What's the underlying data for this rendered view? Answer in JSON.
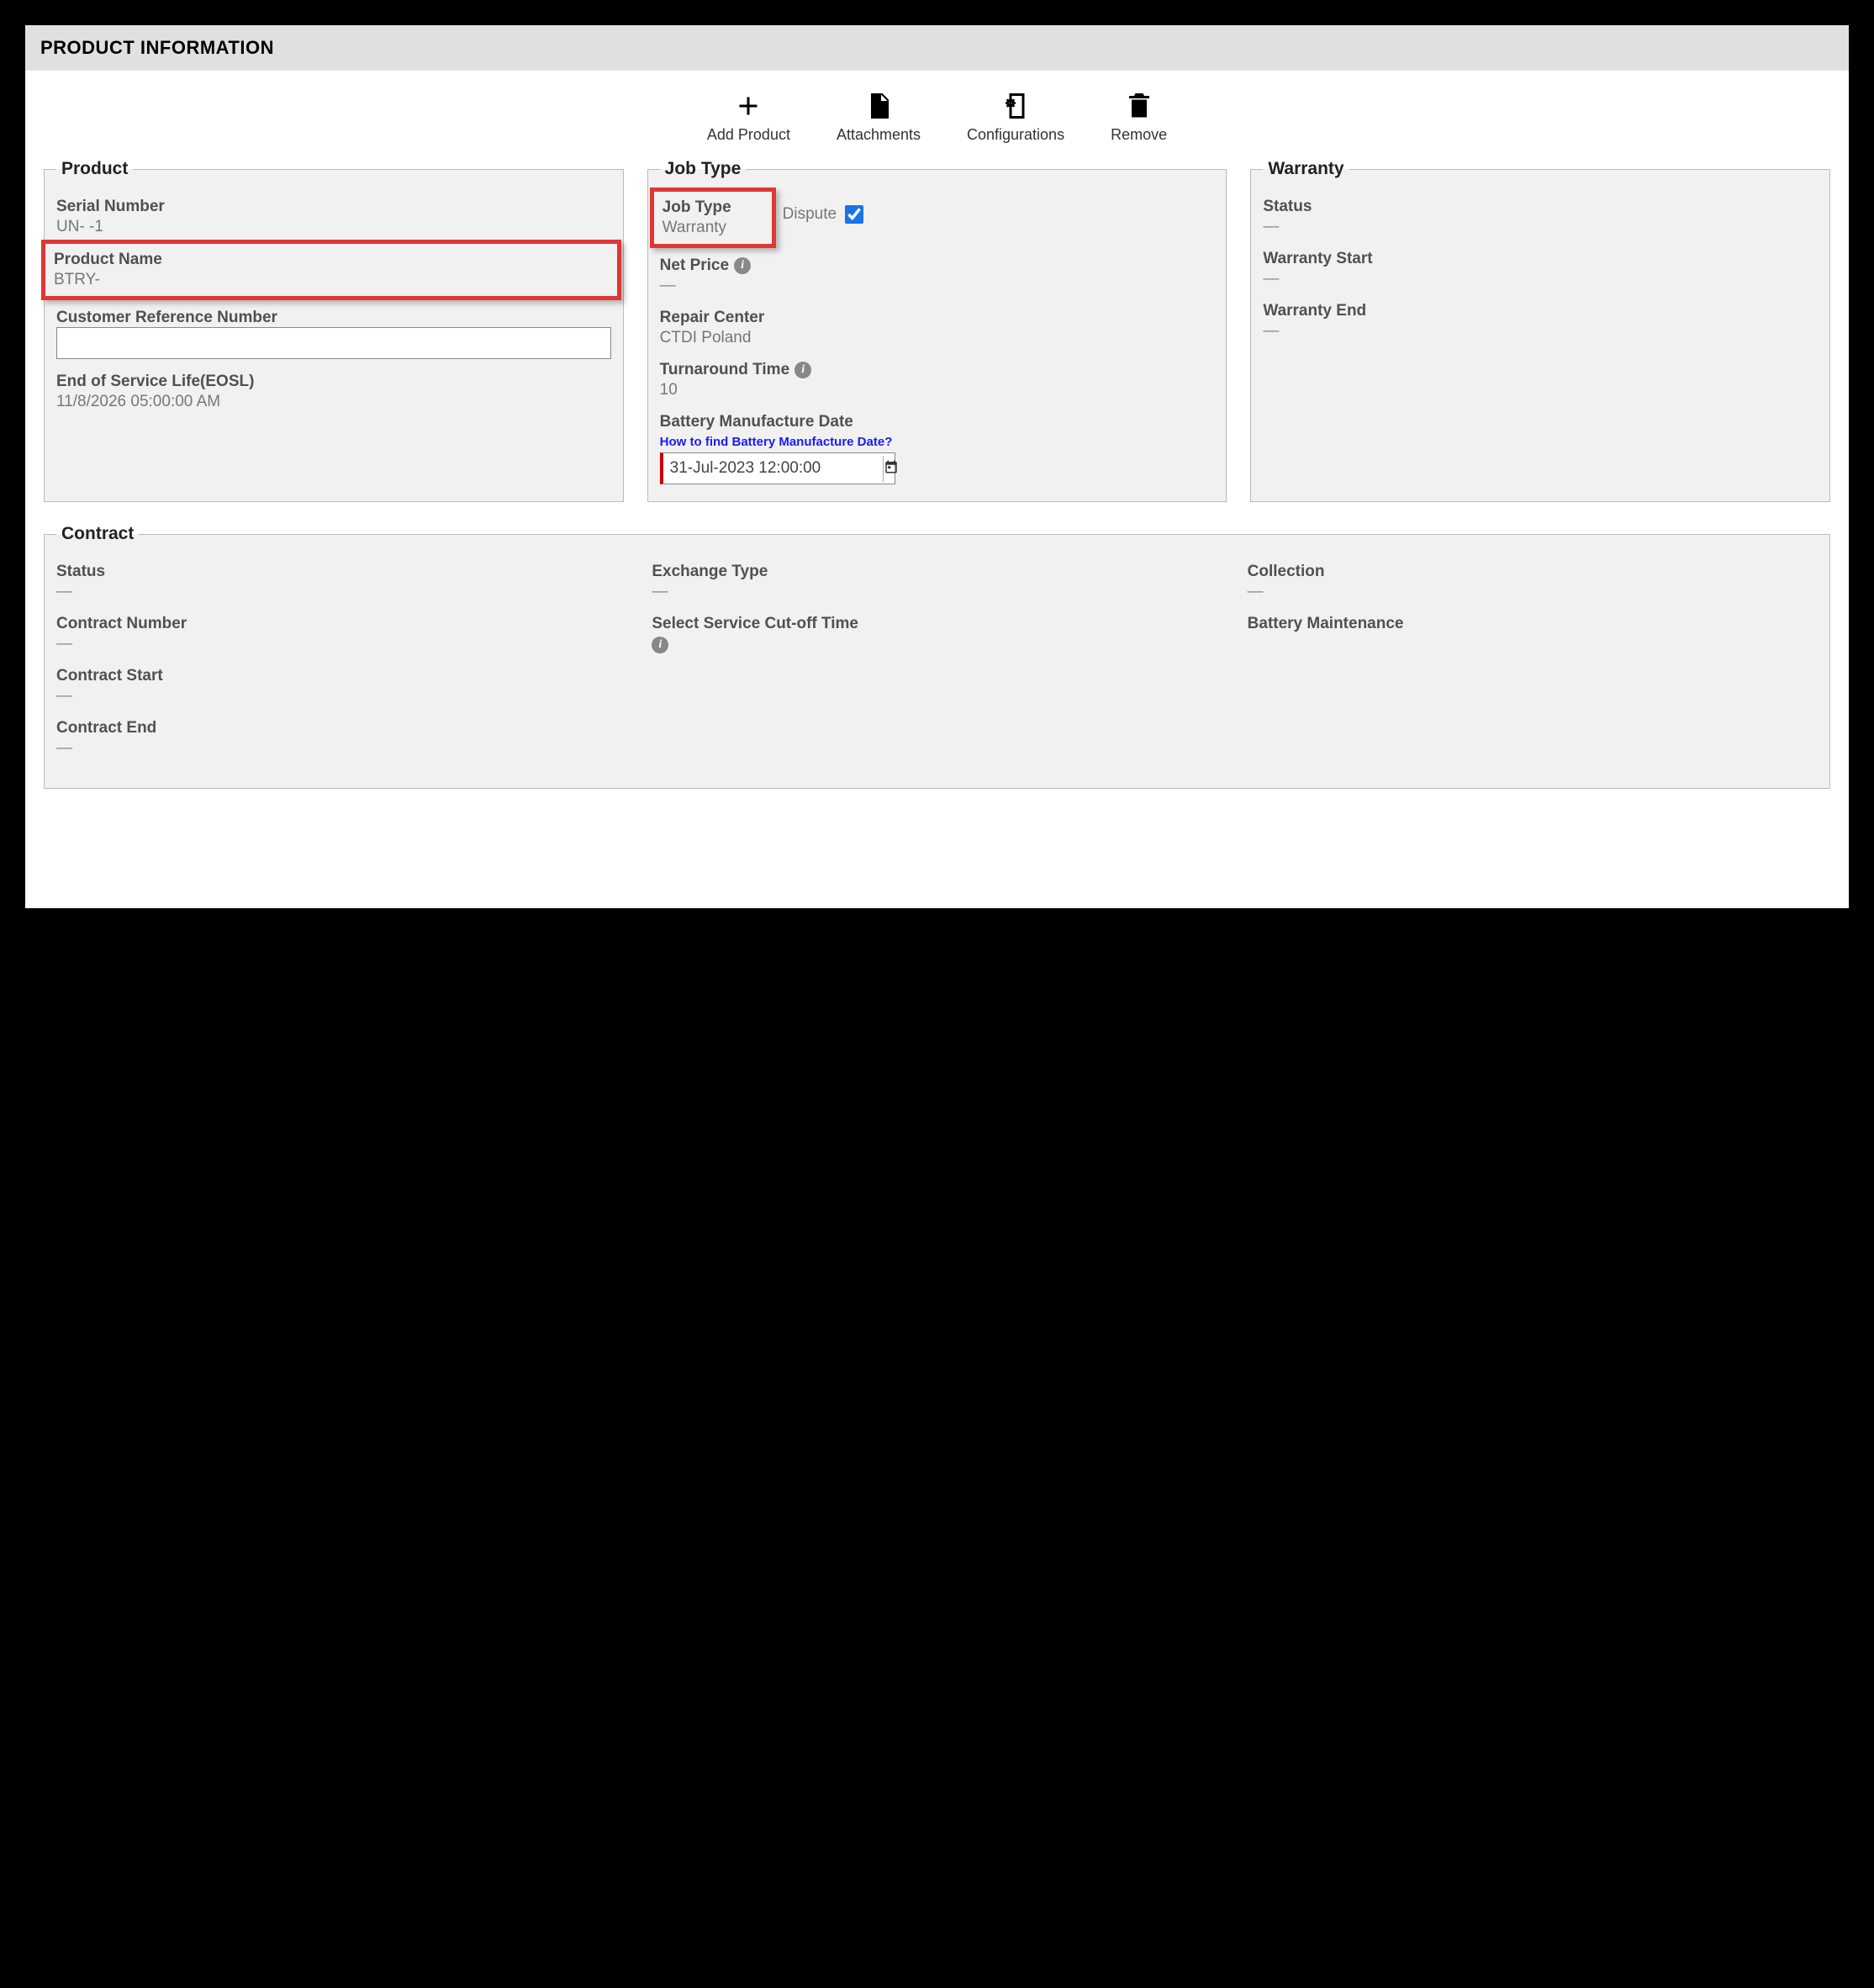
{
  "header": {
    "title": "PRODUCT INFORMATION"
  },
  "toolbar": {
    "add_product": "Add Product",
    "attachments": "Attachments",
    "configurations": "Configurations",
    "remove": "Remove"
  },
  "product": {
    "legend": "Product",
    "serial_label": "Serial Number",
    "serial_value": "UN-               -1",
    "name_label": "Product Name",
    "name_value": "BTRY-",
    "crn_label": "Customer Reference Number",
    "crn_value": "",
    "eosl_label": "End of Service Life(EOSL)",
    "eosl_value": "11/8/2026 05:00:00 AM"
  },
  "jobtype": {
    "legend": "Job Type",
    "jobtype_label": "Job Type",
    "jobtype_value": "Warranty",
    "dispute_label": "Dispute",
    "dispute_checked": true,
    "netprice_label": "Net Price",
    "netprice_value": "—",
    "repair_label": "Repair Center",
    "repair_value": "CTDI Poland",
    "tat_label": "Turnaround Time",
    "tat_value": "10",
    "bmd_label": "Battery Manufacture Date",
    "bmd_help": "How to find Battery Manufacture Date?",
    "bmd_value": "31-Jul-2023 12:00:00"
  },
  "warranty": {
    "legend": "Warranty",
    "status_label": "Status",
    "status_value": "—",
    "wstart_label": "Warranty Start",
    "wstart_value": "—",
    "wend_label": "Warranty End",
    "wend_value": "—"
  },
  "contract": {
    "legend": "Contract",
    "status_label": "Status",
    "status_value": "—",
    "number_label": "Contract Number",
    "number_value": "—",
    "cstart_label": "Contract Start",
    "cstart_value": "—",
    "cend_label": "Contract End",
    "cend_value": "—",
    "exchange_label": "Exchange Type",
    "exchange_value": "—",
    "cutoff_label": "Select Service Cut-off Time",
    "collection_label": "Collection",
    "collection_value": "—",
    "battmaint_label": "Battery Maintenance"
  }
}
